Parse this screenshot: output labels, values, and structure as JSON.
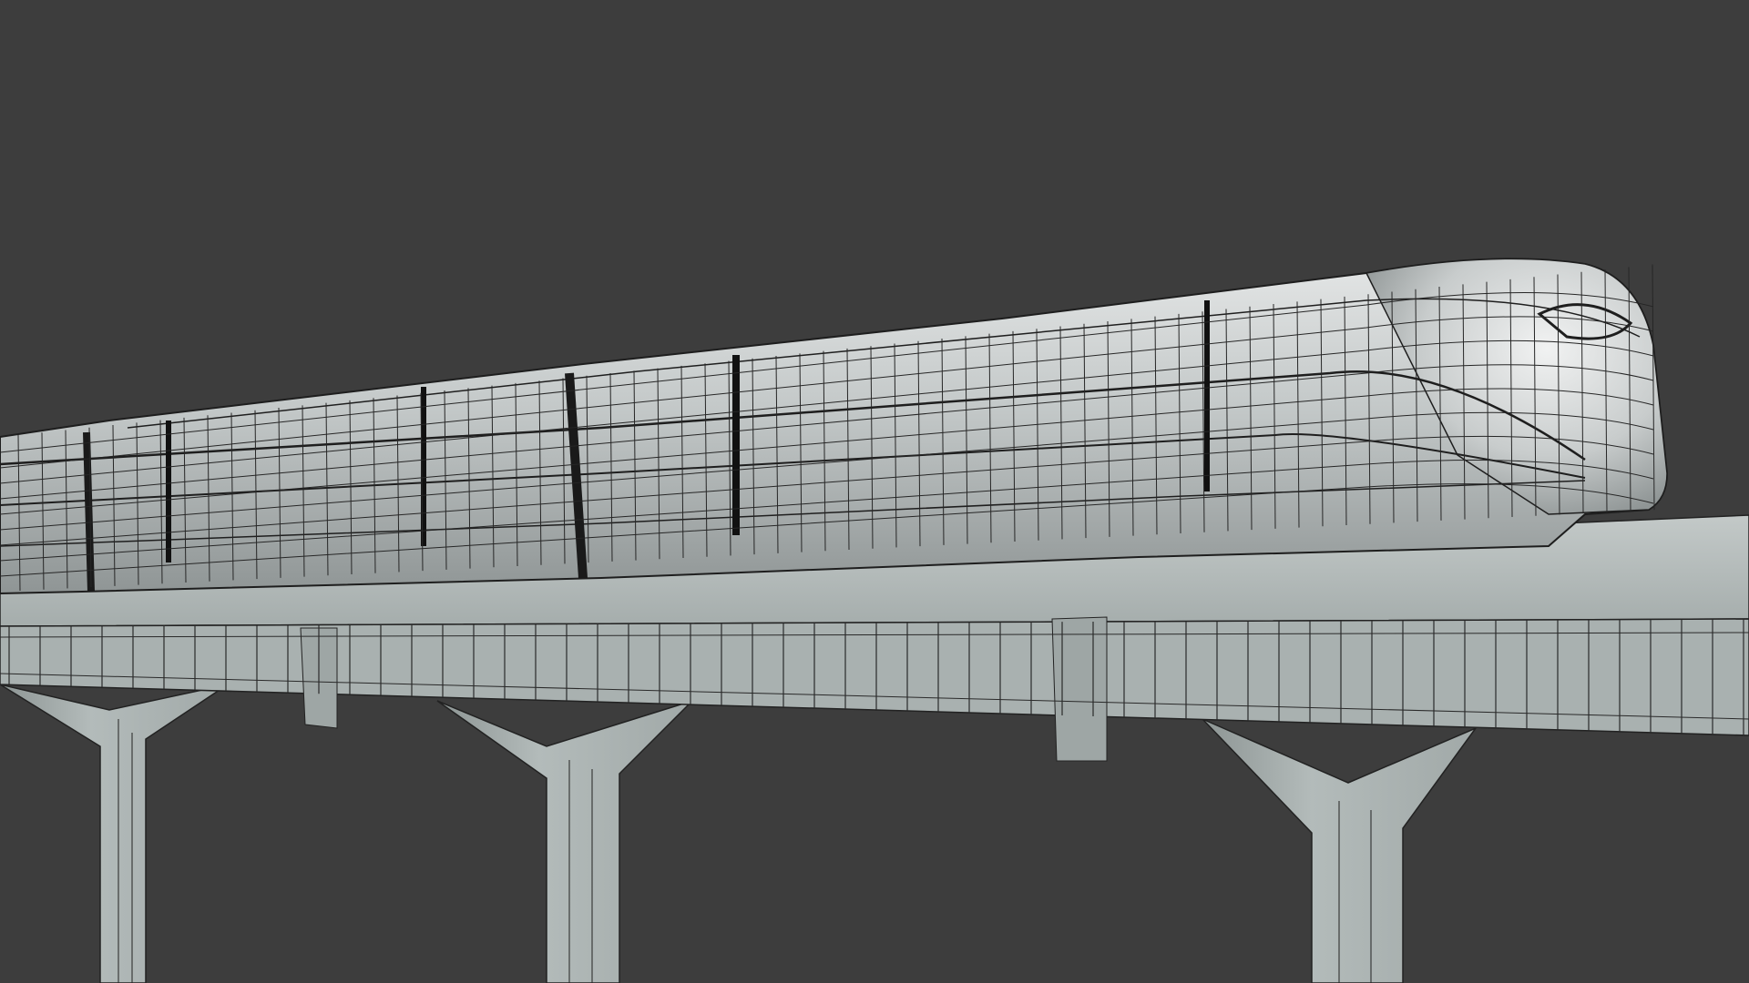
{
  "scene": {
    "background_color": "#3d3d3d",
    "subject": "monorail-train-wireframe",
    "render_style": "solid-shading-with-wireframe-overlay",
    "colors": {
      "train_body": "#b9bebe",
      "train_highlight": "#e2e4e4",
      "train_shadow": "#8f9595",
      "track_top": "#bcc2c1",
      "track_side": "#a9b1b0",
      "pillar": "#aeb6b5",
      "pillar_shadow": "#8e9695",
      "wire": "#1e1e1e"
    },
    "elements": {
      "cars": 3,
      "pillars": 4
    }
  }
}
